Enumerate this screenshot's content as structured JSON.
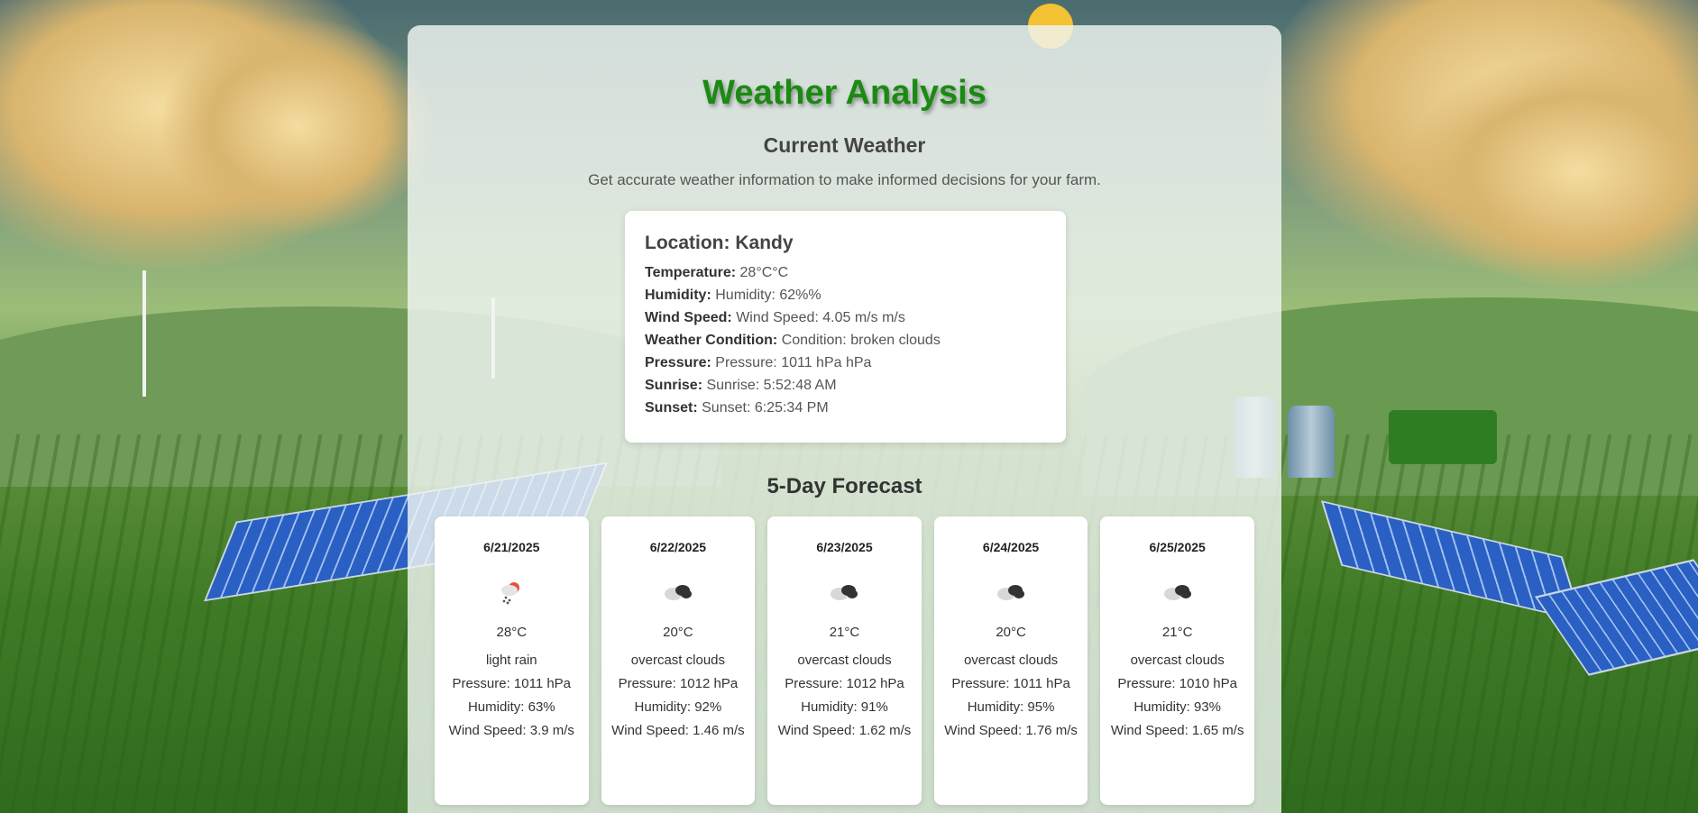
{
  "header": {
    "app_title": "Weather Analysis",
    "section_title": "Current Weather",
    "tagline": "Get accurate weather information to make informed decisions for your farm."
  },
  "current": {
    "location_label": "Location:",
    "location": "Kandy",
    "temperature_label": "Temperature:",
    "temperature": "28°C°C",
    "humidity_label": "Humidity:",
    "humidity": "Humidity: 62%%",
    "wind_label": "Wind Speed:",
    "wind": "Wind Speed: 4.05 m/s m/s",
    "condition_label": "Weather Condition:",
    "condition": "Condition: broken clouds",
    "pressure_label": "Pressure:",
    "pressure": "Pressure: 1011 hPa hPa",
    "sunrise_label": "Sunrise:",
    "sunrise": "Sunrise: 5:52:48 AM",
    "sunset_label": "Sunset:",
    "sunset": "Sunset: 6:25:34 PM"
  },
  "forecast": {
    "title": "5-Day Forecast",
    "days": [
      {
        "date": "6/21/2025",
        "icon": "light-rain-icon",
        "temp": "28°C",
        "desc": "light rain",
        "pressure": "Pressure: 1011 hPa",
        "humidity": "Humidity: 63%",
        "wind": "Wind Speed: 3.9 m/s"
      },
      {
        "date": "6/22/2025",
        "icon": "overcast-clouds-icon",
        "temp": "20°C",
        "desc": "overcast clouds",
        "pressure": "Pressure: 1012 hPa",
        "humidity": "Humidity: 92%",
        "wind": "Wind Speed: 1.46 m/s"
      },
      {
        "date": "6/23/2025",
        "icon": "overcast-clouds-icon",
        "temp": "21°C",
        "desc": "overcast clouds",
        "pressure": "Pressure: 1012 hPa",
        "humidity": "Humidity: 91%",
        "wind": "Wind Speed: 1.62 m/s"
      },
      {
        "date": "6/24/2025",
        "icon": "overcast-clouds-icon",
        "temp": "20°C",
        "desc": "overcast clouds",
        "pressure": "Pressure: 1011 hPa",
        "humidity": "Humidity: 95%",
        "wind": "Wind Speed: 1.76 m/s"
      },
      {
        "date": "6/25/2025",
        "icon": "overcast-clouds-icon",
        "temp": "21°C",
        "desc": "overcast clouds",
        "pressure": "Pressure: 1010 hPa",
        "humidity": "Humidity: 93%",
        "wind": "Wind Speed: 1.65 m/s"
      }
    ]
  },
  "colors": {
    "title_green": "#1b8a12",
    "card_bg": "#ffffff",
    "panel_bg": "rgba(240,245,242,0.82)"
  }
}
